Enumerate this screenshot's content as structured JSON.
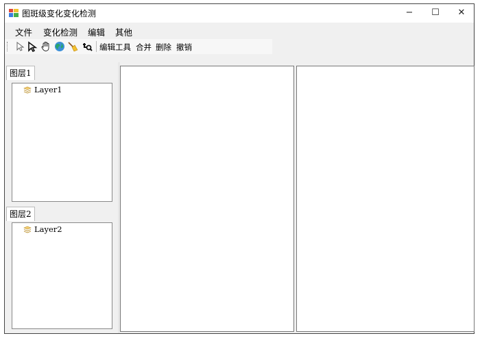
{
  "window": {
    "title": "图斑级变化变化检测"
  },
  "title_buttons": {
    "minimize": "−",
    "maximize": "☐",
    "close": "✕"
  },
  "menu": [
    "文件",
    "变化检测",
    "编辑",
    "其他"
  ],
  "toolbar": {
    "icons": [
      "select-arrow-icon",
      "select-cursor-icon",
      "pan-hand-icon",
      "globe-icon",
      "broom-icon",
      "find-icon"
    ],
    "labels": [
      "编辑工具",
      "合并",
      "删除",
      "撤销"
    ]
  },
  "layers": [
    {
      "header": "图层1",
      "node": "Layer1"
    },
    {
      "header": "图层2",
      "node": "Layer2"
    }
  ],
  "colors": {
    "folder": "#e8b84a",
    "globe": "#2aa56a",
    "border": "#777777"
  }
}
